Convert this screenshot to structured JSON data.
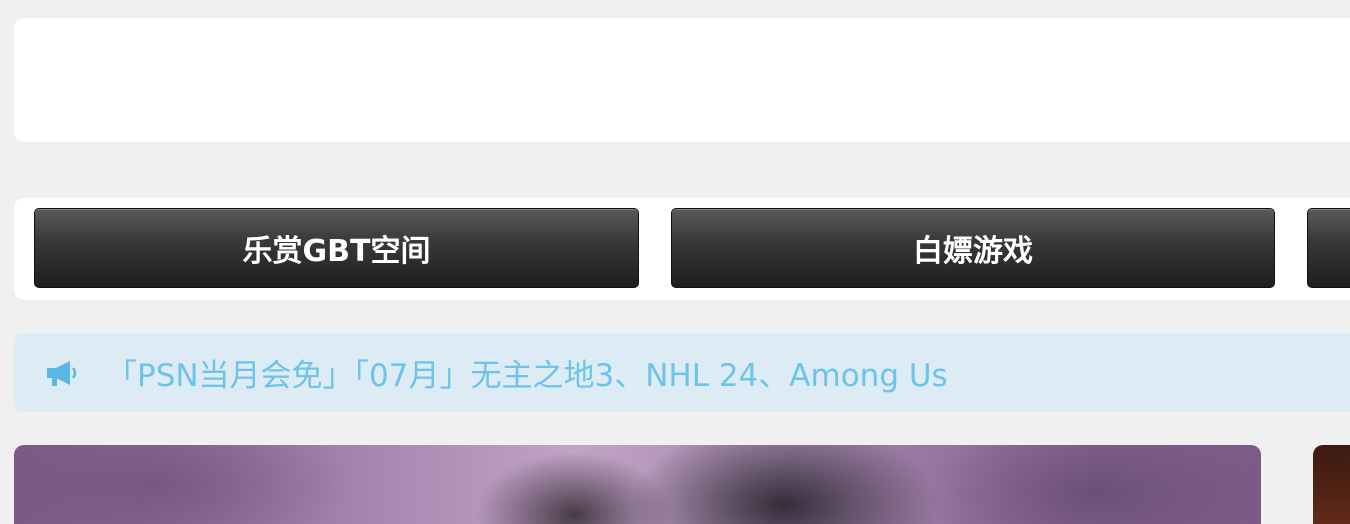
{
  "nav": {
    "buttons": [
      {
        "label": "乐赏GBT空间"
      },
      {
        "label": "白嫖游戏"
      },
      {
        "label": ""
      }
    ]
  },
  "notice": {
    "icon": "megaphone-icon",
    "text": "「PSN当月会免」「07月」无主之地3、NHL 24、Among Us",
    "color": "#6ec3ea"
  },
  "colors": {
    "page_background": "#f0f0f0",
    "notice_background": "#ddecf4",
    "button_dark": "#2a2a2a"
  }
}
